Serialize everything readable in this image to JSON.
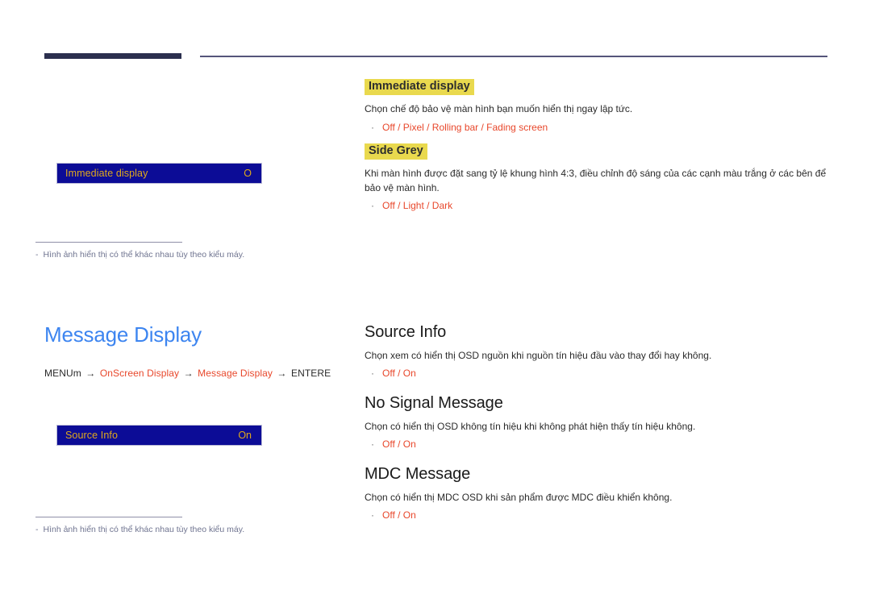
{
  "page": {
    "background": "#ffffff",
    "accent_blue": "#3d85f0",
    "accent_red": "#e8472b",
    "highlight_yellow": "#e9d94e",
    "osd_background": "#0c0c96",
    "osd_text": "#e0a91c"
  },
  "left_column": {
    "osd_previews": [
      {
        "id": "immediate-display",
        "label": "Immediate display",
        "value": "O"
      },
      {
        "id": "source-info",
        "label": "Source Info",
        "value": "On"
      }
    ],
    "notes": [
      {
        "dash": "-",
        "text": "Hình ảnh hiển thị có thể khác nhau tùy theo kiểu máy."
      },
      {
        "dash": "-",
        "text": "Hình ảnh hiển thị có thể khác nhau tùy theo kiểu máy."
      }
    ],
    "section_title": "Message Display",
    "breadcrumb": {
      "start": "MENUm",
      "arrow": "→",
      "item1": "OnScreen Display",
      "item2": "Message Display",
      "end": "ENTERE"
    }
  },
  "right_column": {
    "blocks": [
      {
        "id": "immediate-display",
        "heading": "Immediate display",
        "heading_style": "highlighted",
        "body": "Chọn chế độ bảo vệ màn hình bạn muốn hiển thị ngay lập tức.",
        "bullet": "·",
        "options": [
          "Off",
          "Pixel",
          "Rolling bar",
          "Fading screen"
        ],
        "options_text": "Off / Pixel / Rolling bar  / Fading screen"
      },
      {
        "id": "side-grey",
        "heading": "Side Grey",
        "heading_style": "highlighted",
        "body": "Khi màn hình được đặt sang tỷ lệ khung hình 4:3, điều chỉnh độ sáng của các cạnh màu trắng ở các bên để bảo vệ màn hình.",
        "bullet": "·",
        "options": [
          "Off",
          "Light",
          "Dark"
        ],
        "options_text": "Off / Light  / Dark"
      },
      {
        "id": "source-info",
        "heading": "Source Info",
        "heading_style": "plain",
        "body": "Chọn xem có hiển thị OSD nguồn khi nguồn tín hiệu đầu vào thay đổi hay không.",
        "bullet": "·",
        "options": [
          "Off",
          "On"
        ],
        "options_text": "Off / On"
      },
      {
        "id": "no-signal-message",
        "heading": "No Signal Message",
        "heading_style": "plain",
        "body": "Chọn có hiển thị OSD không tín hiệu khi không phát hiện thấy tín hiệu không.",
        "bullet": "·",
        "options": [
          "Off",
          "On"
        ],
        "options_text": "Off / On"
      },
      {
        "id": "mdc-message",
        "heading": "MDC Message",
        "heading_style": "plain",
        "body": "Chọn có hiển thị MDC OSD khi sản phẩm được MDC điều khiển không.",
        "bullet": "·",
        "options": [
          "Off",
          "On"
        ],
        "options_text": "Off / On"
      }
    ]
  }
}
